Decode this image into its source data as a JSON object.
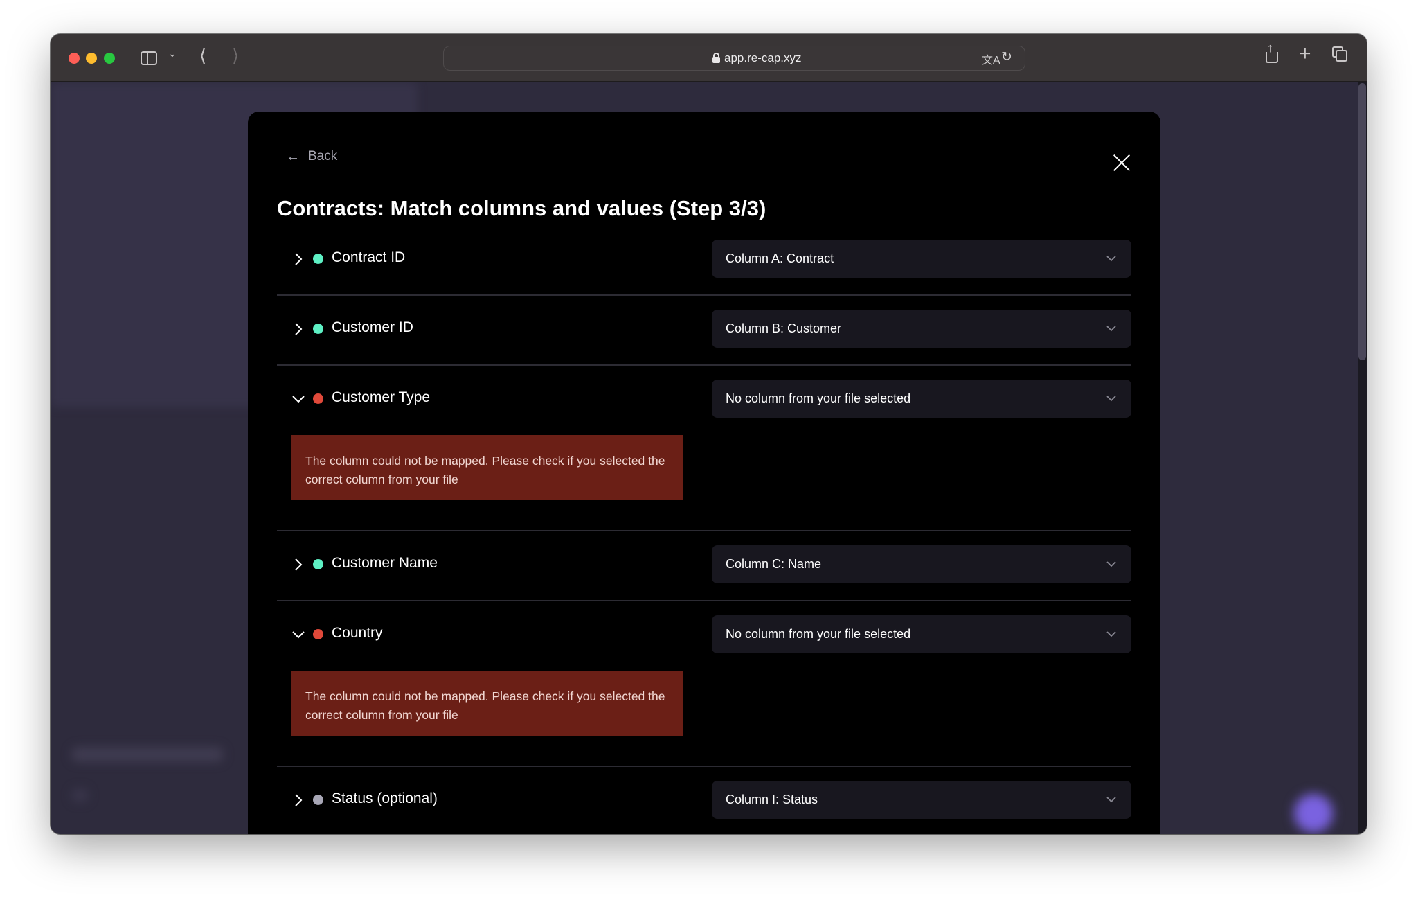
{
  "browser": {
    "url": "app.re-cap.xyz",
    "icons": [
      "sidebar-toggle-icon",
      "chevron-down-icon",
      "back-icon",
      "forward-icon",
      "lock-icon",
      "translate-icon",
      "reload-icon",
      "share-icon",
      "new-tab-icon",
      "tab-overview-icon"
    ]
  },
  "modal": {
    "back_label": "Back",
    "title": "Contracts: Match columns and values (Step 3/3)",
    "fields": [
      {
        "label": "Contract ID",
        "status": "mapped",
        "status_color": "#5ef0c4",
        "expanded": false,
        "selected": "Column A: Contract"
      },
      {
        "label": "Customer ID",
        "status": "mapped",
        "status_color": "#5ef0c4",
        "expanded": false,
        "selected": "Column B: Customer"
      },
      {
        "label": "Customer Type",
        "status": "error",
        "status_color": "#e0493a",
        "expanded": true,
        "selected": "No column from your file selected",
        "error": "The column could not be mapped. Please check if you selected the correct column from your file"
      },
      {
        "label": "Customer Name",
        "status": "mapped",
        "status_color": "#5ef0c4",
        "expanded": false,
        "selected": "Column C: Name"
      },
      {
        "label": "Country",
        "status": "error",
        "status_color": "#e0493a",
        "expanded": true,
        "selected": "No column from your file selected",
        "error": "The column could not be mapped. Please check if you selected the correct column from your file"
      },
      {
        "label": "Status (optional)",
        "status": "optional",
        "status_color": "#a8a7b6",
        "expanded": false,
        "selected": "Column I: Status"
      }
    ]
  },
  "colors": {
    "modal_bg": "#000000",
    "page_bg": "#2e2b3d",
    "select_bg": "#18171f",
    "error_bg": "#6b1f16",
    "chat_button": "#7a62e0"
  }
}
